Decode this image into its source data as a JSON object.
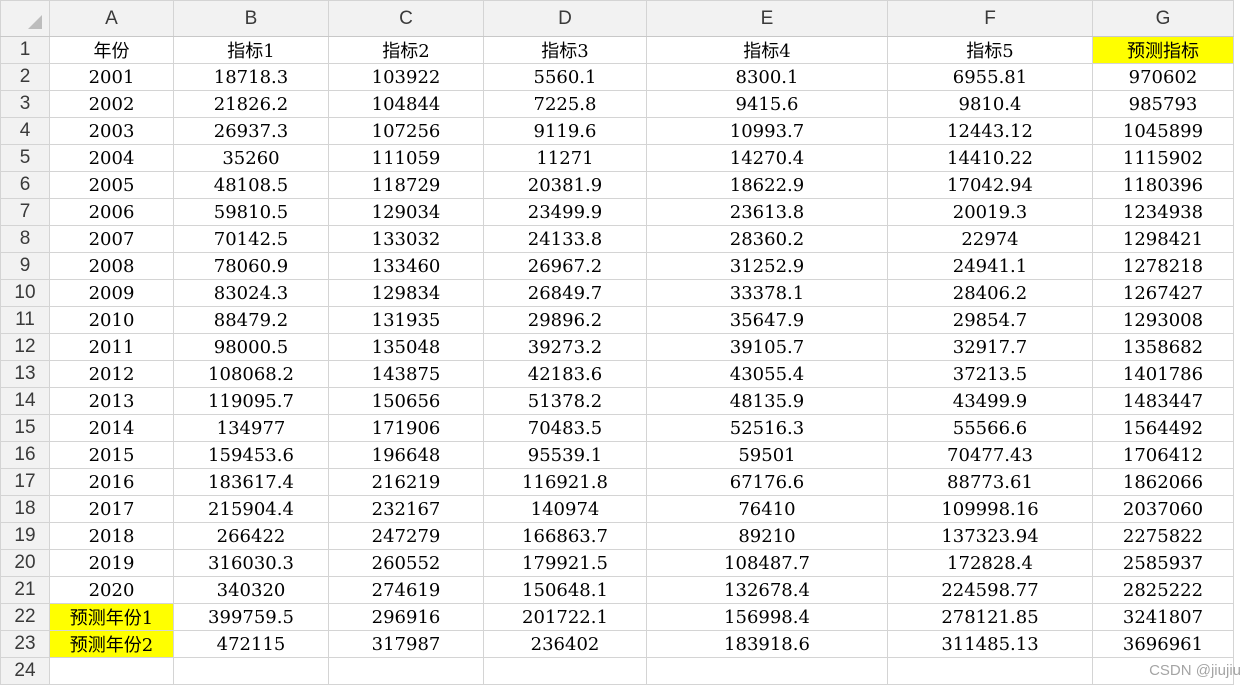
{
  "columns": [
    "A",
    "B",
    "C",
    "D",
    "E",
    "F",
    "G"
  ],
  "row_numbers": [
    "1",
    "2",
    "3",
    "4",
    "5",
    "6",
    "7",
    "8",
    "9",
    "10",
    "11",
    "12",
    "13",
    "14",
    "15",
    "16",
    "17",
    "18",
    "19",
    "20",
    "21",
    "22",
    "23",
    "24"
  ],
  "highlight_color": "#ffff00",
  "rows": [
    [
      "年份",
      "指标1",
      "指标2",
      "指标3",
      "指标4",
      "指标5",
      "预测指标"
    ],
    [
      "2001",
      "18718.3",
      "103922",
      "5560.1",
      "8300.1",
      "6955.81",
      "970602"
    ],
    [
      "2002",
      "21826.2",
      "104844",
      "7225.8",
      "9415.6",
      "9810.4",
      "985793"
    ],
    [
      "2003",
      "26937.3",
      "107256",
      "9119.6",
      "10993.7",
      "12443.12",
      "1045899"
    ],
    [
      "2004",
      "35260",
      "111059",
      "11271",
      "14270.4",
      "14410.22",
      "1115902"
    ],
    [
      "2005",
      "48108.5",
      "118729",
      "20381.9",
      "18622.9",
      "17042.94",
      "1180396"
    ],
    [
      "2006",
      "59810.5",
      "129034",
      "23499.9",
      "23613.8",
      "20019.3",
      "1234938"
    ],
    [
      "2007",
      "70142.5",
      "133032",
      "24133.8",
      "28360.2",
      "22974",
      "1298421"
    ],
    [
      "2008",
      "78060.9",
      "133460",
      "26967.2",
      "31252.9",
      "24941.1",
      "1278218"
    ],
    [
      "2009",
      "83024.3",
      "129834",
      "26849.7",
      "33378.1",
      "28406.2",
      "1267427"
    ],
    [
      "2010",
      "88479.2",
      "131935",
      "29896.2",
      "35647.9",
      "29854.7",
      "1293008"
    ],
    [
      "2011",
      "98000.5",
      "135048",
      "39273.2",
      "39105.7",
      "32917.7",
      "1358682"
    ],
    [
      "2012",
      "108068.2",
      "143875",
      "42183.6",
      "43055.4",
      "37213.5",
      "1401786"
    ],
    [
      "2013",
      "119095.7",
      "150656",
      "51378.2",
      "48135.9",
      "43499.9",
      "1483447"
    ],
    [
      "2014",
      "134977",
      "171906",
      "70483.5",
      "52516.3",
      "55566.6",
      "1564492"
    ],
    [
      "2015",
      "159453.6",
      "196648",
      "95539.1",
      "59501",
      "70477.43",
      "1706412"
    ],
    [
      "2016",
      "183617.4",
      "216219",
      "116921.8",
      "67176.6",
      "88773.61",
      "1862066"
    ],
    [
      "2017",
      "215904.4",
      "232167",
      "140974",
      "76410",
      "109998.16",
      "2037060"
    ],
    [
      "2018",
      "266422",
      "247279",
      "166863.7",
      "89210",
      "137323.94",
      "2275822"
    ],
    [
      "2019",
      "316030.3",
      "260552",
      "179921.5",
      "108487.7",
      "172828.4",
      "2585937"
    ],
    [
      "2020",
      "340320",
      "274619",
      "150648.1",
      "132678.4",
      "224598.77",
      "2825222"
    ],
    [
      "预测年份1",
      "399759.5",
      "296916",
      "201722.1",
      "156998.4",
      "278121.85",
      "3241807"
    ],
    [
      "预测年份2",
      "472115",
      "317987",
      "236402",
      "183918.6",
      "311485.13",
      "3696961"
    ],
    [
      "",
      "",
      "",
      "",
      "",
      "",
      ""
    ]
  ],
  "highlighted_cells": [
    [
      0,
      6
    ],
    [
      21,
      0
    ],
    [
      22,
      0
    ]
  ],
  "watermark": "CSDN @jiujiu"
}
